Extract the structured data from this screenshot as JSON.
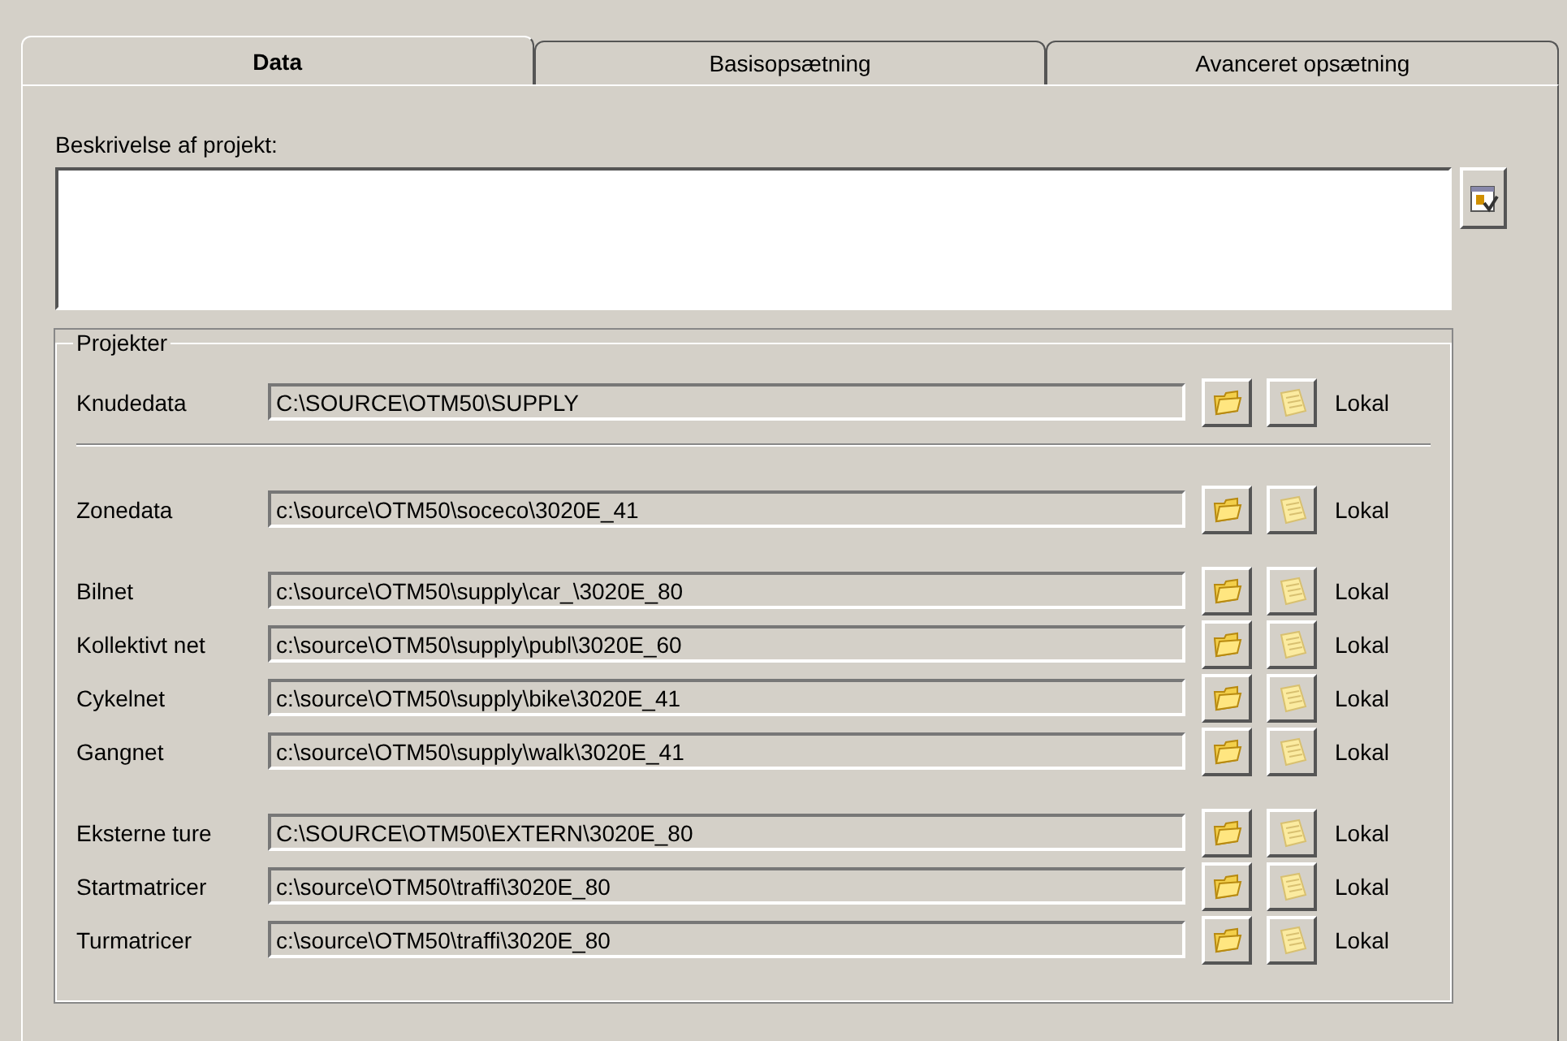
{
  "tabs": [
    {
      "label": "Data",
      "selected": true
    },
    {
      "label": "Basisopsætning",
      "selected": false
    },
    {
      "label": "Avanceret opsætning",
      "selected": false
    }
  ],
  "description": {
    "label": "Beskrivelse af projekt:"
  },
  "projects": {
    "title": "Projekter",
    "groups": [
      {
        "divider_below": true,
        "rows": [
          {
            "label": "Knudedata",
            "path": "C:\\SOURCE\\OTM50\\SUPPLY",
            "scope": "Lokal"
          }
        ]
      },
      {
        "divider_below": false,
        "rows": [
          {
            "label": "Zonedata",
            "path": "c:\\source\\OTM50\\soceco\\3020E_41",
            "scope": "Lokal"
          }
        ]
      },
      {
        "divider_below": false,
        "rows": [
          {
            "label": "Bilnet",
            "path": "c:\\source\\OTM50\\supply\\car_\\3020E_80",
            "scope": "Lokal"
          },
          {
            "label": "Kollektivt net",
            "path": "c:\\source\\OTM50\\supply\\publ\\3020E_60",
            "scope": "Lokal"
          },
          {
            "label": "Cykelnet",
            "path": "c:\\source\\OTM50\\supply\\bike\\3020E_41",
            "scope": "Lokal"
          },
          {
            "label": "Gangnet",
            "path": "c:\\source\\OTM50\\supply\\walk\\3020E_41",
            "scope": "Lokal"
          }
        ]
      },
      {
        "divider_below": false,
        "rows": [
          {
            "label": "Eksterne ture",
            "path": "C:\\SOURCE\\OTM50\\EXTERN\\3020E_80",
            "scope": "Lokal"
          },
          {
            "label": "Startmatricer",
            "path": "c:\\source\\OTM50\\traffi\\3020E_80",
            "scope": "Lokal"
          },
          {
            "label": "Turmatricer",
            "path": "c:\\source\\OTM50\\traffi\\3020E_80",
            "scope": "Lokal"
          }
        ]
      }
    ]
  }
}
